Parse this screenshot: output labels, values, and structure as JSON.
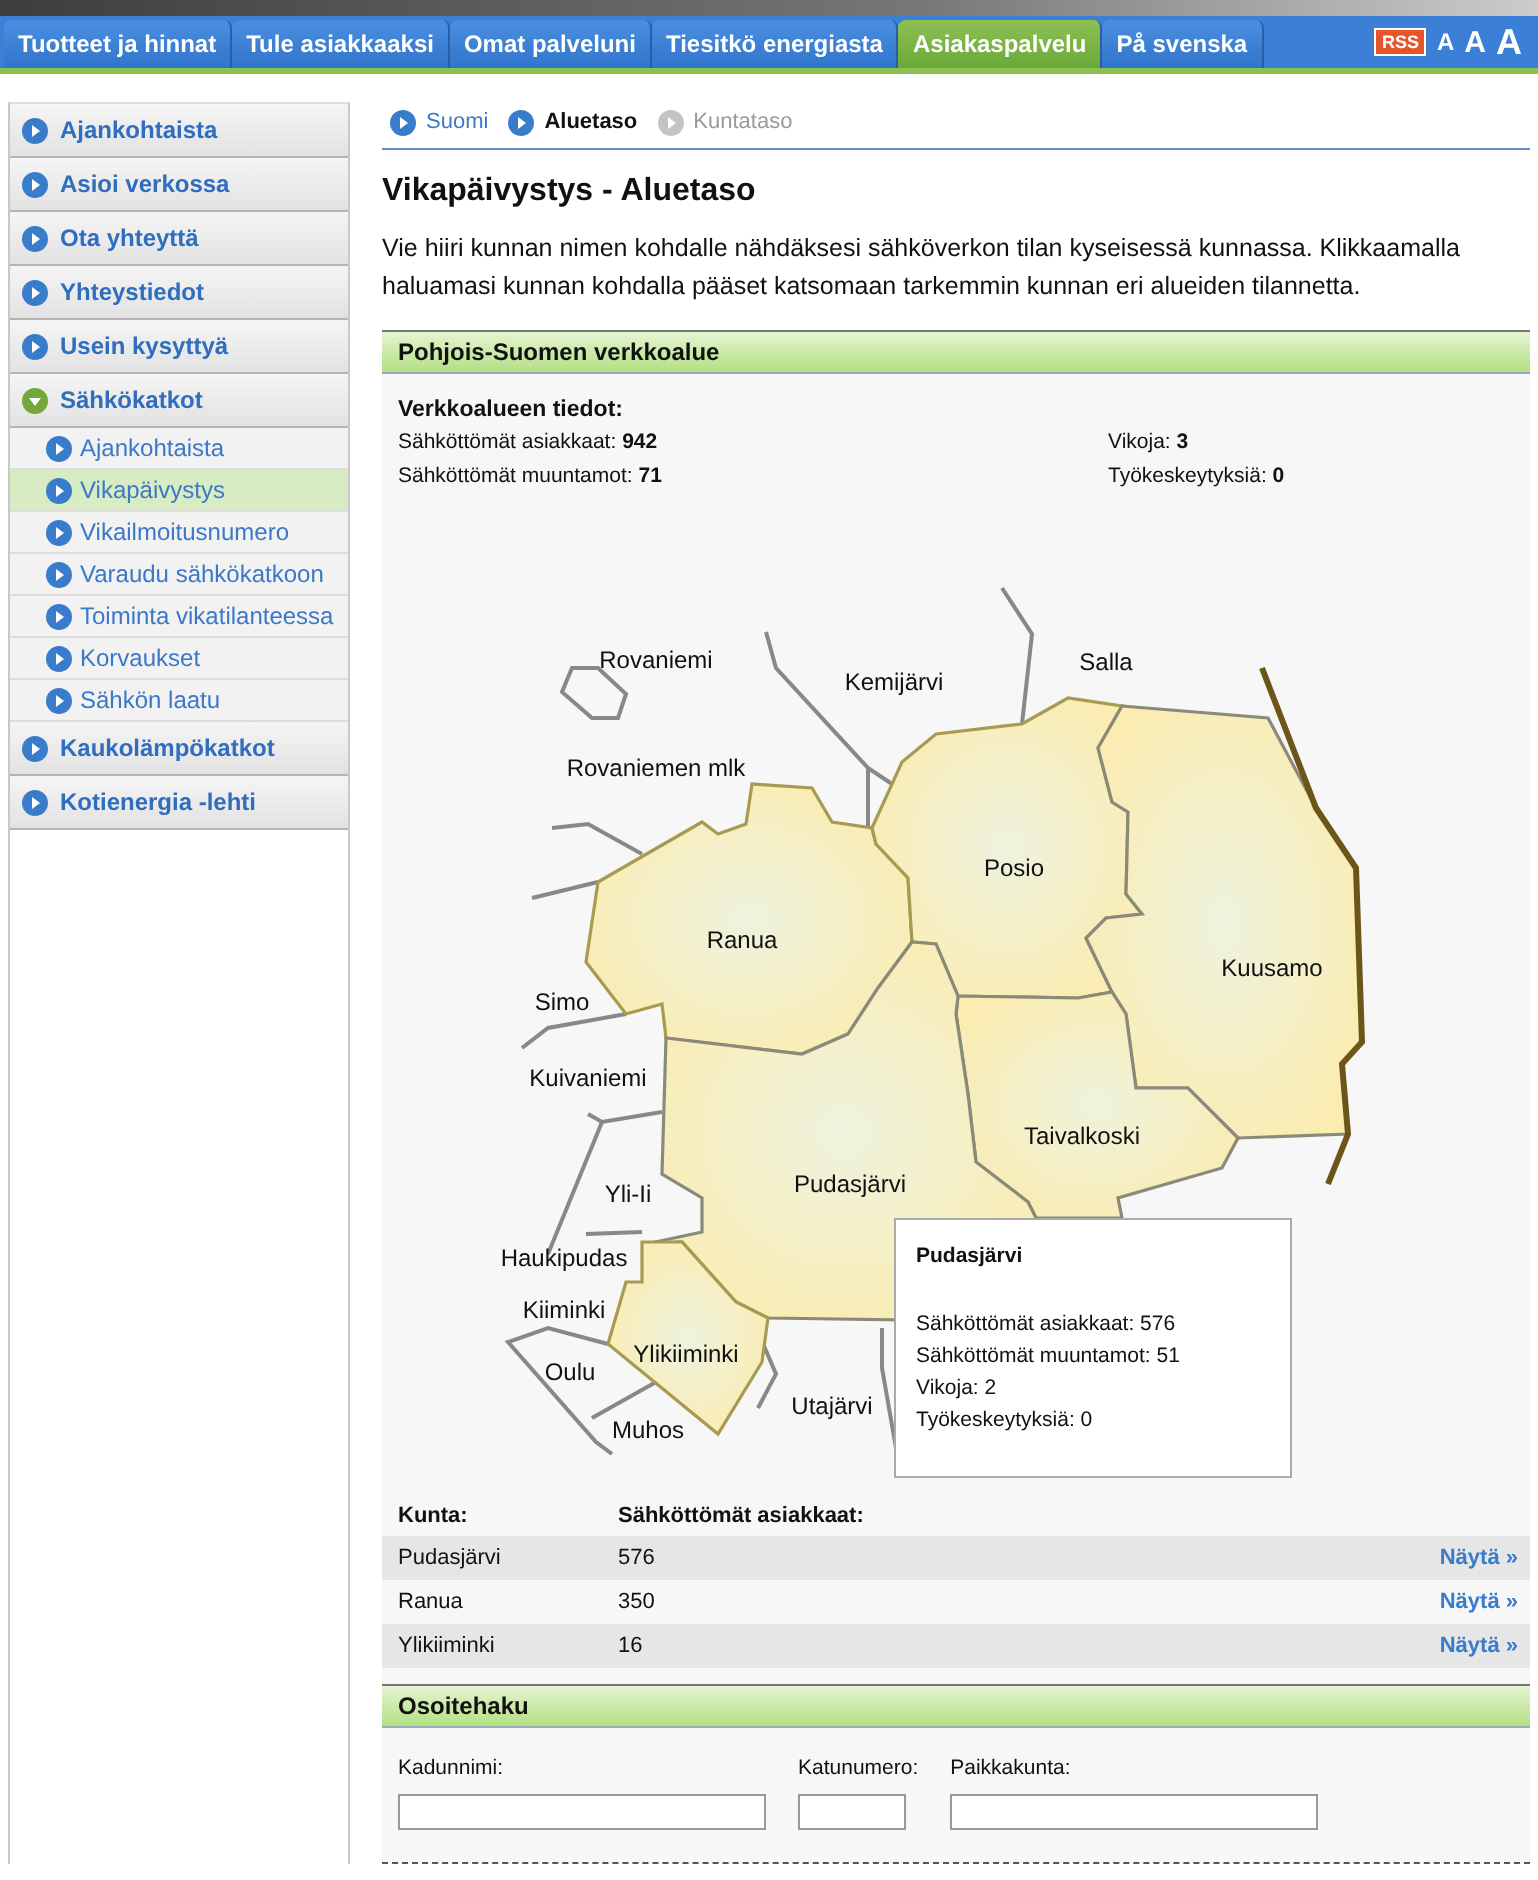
{
  "nav": {
    "tabs": [
      {
        "label": "Tuotteet ja hinnat",
        "selected": false
      },
      {
        "label": "Tule asiakkaaksi",
        "selected": false
      },
      {
        "label": "Omat palveluni",
        "selected": false
      },
      {
        "label": "Tiesitkö energiasta",
        "selected": false
      },
      {
        "label": "Asiakaspalvelu",
        "selected": true
      },
      {
        "label": "På svenska",
        "selected": false
      }
    ],
    "rss": "RSS",
    "text_sizes": [
      "A",
      "A",
      "A"
    ]
  },
  "sidebar": {
    "items": [
      {
        "label": "Ajankohtaista",
        "selected": false,
        "expanded": false
      },
      {
        "label": "Asioi verkossa",
        "selected": false,
        "expanded": false
      },
      {
        "label": "Ota yhteyttä",
        "selected": false,
        "expanded": false
      },
      {
        "label": "Yhteystiedot",
        "selected": false,
        "expanded": false
      },
      {
        "label": "Usein kysyttyä",
        "selected": false,
        "expanded": false
      },
      {
        "label": "Sähkökatkot",
        "selected": false,
        "expanded": true,
        "children": [
          {
            "label": "Ajankohtaista",
            "selected": false
          },
          {
            "label": "Vikapäivystys",
            "selected": true
          },
          {
            "label": "Vikailmoitusnumero",
            "selected": false
          },
          {
            "label": "Varaudu sähkökatkoon",
            "selected": false
          },
          {
            "label": "Toiminta vikatilanteessa",
            "selected": false
          },
          {
            "label": "Korvaukset",
            "selected": false
          },
          {
            "label": "Sähkön laatu",
            "selected": false
          }
        ]
      },
      {
        "label": "Kaukolämpökatkot",
        "selected": false,
        "expanded": false
      },
      {
        "label": "Kotienergia -lehti",
        "selected": false,
        "expanded": false
      }
    ]
  },
  "breadcrumb": [
    {
      "label": "Suomi",
      "kind": "link"
    },
    {
      "label": "Aluetaso",
      "kind": "current"
    },
    {
      "label": "Kuntataso",
      "kind": "disabled"
    }
  ],
  "title": "Vikapäivystys - Aluetaso",
  "intro": "Vie hiiri kunnan nimen kohdalle nähdäksesi sähköverkon tilan kyseisessä kunnassa. Klikkaamalla haluamasi kunnan kohdalla pääset katsomaan tarkemmin kunnan eri alueiden tilannetta.",
  "region": {
    "title": "Pohjois-Suomen verkkoalue",
    "info_heading": "Verkkoalueen tiedot:",
    "stats": [
      {
        "label": "Sähköttömät asiakkaat:",
        "value": "942"
      },
      {
        "label": "Vikoja:",
        "value": "3"
      },
      {
        "label": "Sähköttömät muuntamot:",
        "value": "71"
      },
      {
        "label": "Työkeskeytyksiä:",
        "value": "0"
      }
    ]
  },
  "map": {
    "places": [
      "Rovaniemi",
      "Kemijärvi",
      "Salla",
      "Rovaniemen mlk",
      "Ranua",
      "Posio",
      "Kuusamo",
      "Simo",
      "Kuivaniemi",
      "Taivalkoski",
      "Yli-Ii",
      "Pudasjärvi",
      "Haukipudas",
      "Kiiminki",
      "Ylikiiminki",
      "Oulu",
      "Muhos",
      "Utajärvi"
    ],
    "tooltip": {
      "title": "Pudasjärvi",
      "lines": [
        "Sähköttömät asiakkaat: 576",
        "Sähköttömät muuntamot: 51",
        "Vikoja: 2",
        "Työkeskeytyksiä: 0"
      ]
    }
  },
  "table": {
    "columns": [
      "Kunta:",
      "Sähköttömät asiakkaat:"
    ],
    "rows": [
      {
        "kunta": "Pudasjärvi",
        "count": "576",
        "link": "Näytä »"
      },
      {
        "kunta": "Ranua",
        "count": "350",
        "link": "Näytä »"
      },
      {
        "kunta": "Ylikiiminki",
        "count": "16",
        "link": "Näytä »"
      }
    ]
  },
  "address_search": {
    "title": "Osoitehaku",
    "fields": [
      {
        "label": "Kadunnimi:",
        "kind": "wide"
      },
      {
        "label": "Katunumero:",
        "kind": "narrow"
      },
      {
        "label": "Paikkakunta:",
        "kind": "wide"
      }
    ]
  }
}
